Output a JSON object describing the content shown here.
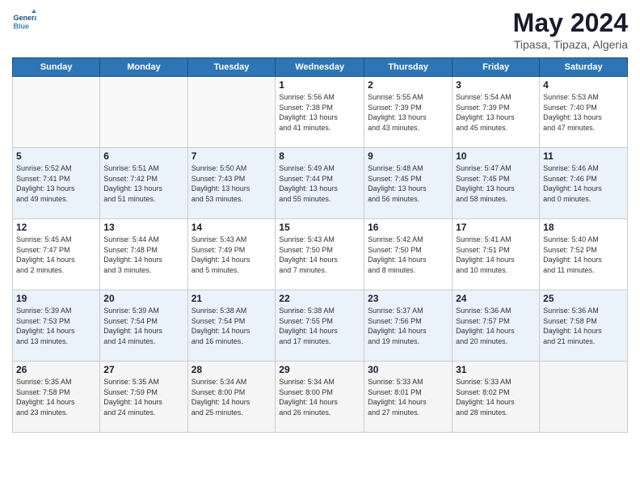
{
  "header": {
    "logo_line1": "General",
    "logo_line2": "Blue",
    "title": "May 2024",
    "location": "Tipasa, Tipaza, Algeria"
  },
  "weekdays": [
    "Sunday",
    "Monday",
    "Tuesday",
    "Wednesday",
    "Thursday",
    "Friday",
    "Saturday"
  ],
  "weeks": [
    [
      {
        "day": "",
        "info": ""
      },
      {
        "day": "",
        "info": ""
      },
      {
        "day": "",
        "info": ""
      },
      {
        "day": "1",
        "info": "Sunrise: 5:56 AM\nSunset: 7:38 PM\nDaylight: 13 hours\nand 41 minutes."
      },
      {
        "day": "2",
        "info": "Sunrise: 5:55 AM\nSunset: 7:39 PM\nDaylight: 13 hours\nand 43 minutes."
      },
      {
        "day": "3",
        "info": "Sunrise: 5:54 AM\nSunset: 7:39 PM\nDaylight: 13 hours\nand 45 minutes."
      },
      {
        "day": "4",
        "info": "Sunrise: 5:53 AM\nSunset: 7:40 PM\nDaylight: 13 hours\nand 47 minutes."
      }
    ],
    [
      {
        "day": "5",
        "info": "Sunrise: 5:52 AM\nSunset: 7:41 PM\nDaylight: 13 hours\nand 49 minutes."
      },
      {
        "day": "6",
        "info": "Sunrise: 5:51 AM\nSunset: 7:42 PM\nDaylight: 13 hours\nand 51 minutes."
      },
      {
        "day": "7",
        "info": "Sunrise: 5:50 AM\nSunset: 7:43 PM\nDaylight: 13 hours\nand 53 minutes."
      },
      {
        "day": "8",
        "info": "Sunrise: 5:49 AM\nSunset: 7:44 PM\nDaylight: 13 hours\nand 55 minutes."
      },
      {
        "day": "9",
        "info": "Sunrise: 5:48 AM\nSunset: 7:45 PM\nDaylight: 13 hours\nand 56 minutes."
      },
      {
        "day": "10",
        "info": "Sunrise: 5:47 AM\nSunset: 7:45 PM\nDaylight: 13 hours\nand 58 minutes."
      },
      {
        "day": "11",
        "info": "Sunrise: 5:46 AM\nSunset: 7:46 PM\nDaylight: 14 hours\nand 0 minutes."
      }
    ],
    [
      {
        "day": "12",
        "info": "Sunrise: 5:45 AM\nSunset: 7:47 PM\nDaylight: 14 hours\nand 2 minutes."
      },
      {
        "day": "13",
        "info": "Sunrise: 5:44 AM\nSunset: 7:48 PM\nDaylight: 14 hours\nand 3 minutes."
      },
      {
        "day": "14",
        "info": "Sunrise: 5:43 AM\nSunset: 7:49 PM\nDaylight: 14 hours\nand 5 minutes."
      },
      {
        "day": "15",
        "info": "Sunrise: 5:43 AM\nSunset: 7:50 PM\nDaylight: 14 hours\nand 7 minutes."
      },
      {
        "day": "16",
        "info": "Sunrise: 5:42 AM\nSunset: 7:50 PM\nDaylight: 14 hours\nand 8 minutes."
      },
      {
        "day": "17",
        "info": "Sunrise: 5:41 AM\nSunset: 7:51 PM\nDaylight: 14 hours\nand 10 minutes."
      },
      {
        "day": "18",
        "info": "Sunrise: 5:40 AM\nSunset: 7:52 PM\nDaylight: 14 hours\nand 11 minutes."
      }
    ],
    [
      {
        "day": "19",
        "info": "Sunrise: 5:39 AM\nSunset: 7:53 PM\nDaylight: 14 hours\nand 13 minutes."
      },
      {
        "day": "20",
        "info": "Sunrise: 5:39 AM\nSunset: 7:54 PM\nDaylight: 14 hours\nand 14 minutes."
      },
      {
        "day": "21",
        "info": "Sunrise: 5:38 AM\nSunset: 7:54 PM\nDaylight: 14 hours\nand 16 minutes."
      },
      {
        "day": "22",
        "info": "Sunrise: 5:38 AM\nSunset: 7:55 PM\nDaylight: 14 hours\nand 17 minutes."
      },
      {
        "day": "23",
        "info": "Sunrise: 5:37 AM\nSunset: 7:56 PM\nDaylight: 14 hours\nand 19 minutes."
      },
      {
        "day": "24",
        "info": "Sunrise: 5:36 AM\nSunset: 7:57 PM\nDaylight: 14 hours\nand 20 minutes."
      },
      {
        "day": "25",
        "info": "Sunrise: 5:36 AM\nSunset: 7:58 PM\nDaylight: 14 hours\nand 21 minutes."
      }
    ],
    [
      {
        "day": "26",
        "info": "Sunrise: 5:35 AM\nSunset: 7:58 PM\nDaylight: 14 hours\nand 23 minutes."
      },
      {
        "day": "27",
        "info": "Sunrise: 5:35 AM\nSunset: 7:59 PM\nDaylight: 14 hours\nand 24 minutes."
      },
      {
        "day": "28",
        "info": "Sunrise: 5:34 AM\nSunset: 8:00 PM\nDaylight: 14 hours\nand 25 minutes."
      },
      {
        "day": "29",
        "info": "Sunrise: 5:34 AM\nSunset: 8:00 PM\nDaylight: 14 hours\nand 26 minutes."
      },
      {
        "day": "30",
        "info": "Sunrise: 5:33 AM\nSunset: 8:01 PM\nDaylight: 14 hours\nand 27 minutes."
      },
      {
        "day": "31",
        "info": "Sunrise: 5:33 AM\nSunset: 8:02 PM\nDaylight: 14 hours\nand 28 minutes."
      },
      {
        "day": "",
        "info": ""
      }
    ]
  ]
}
